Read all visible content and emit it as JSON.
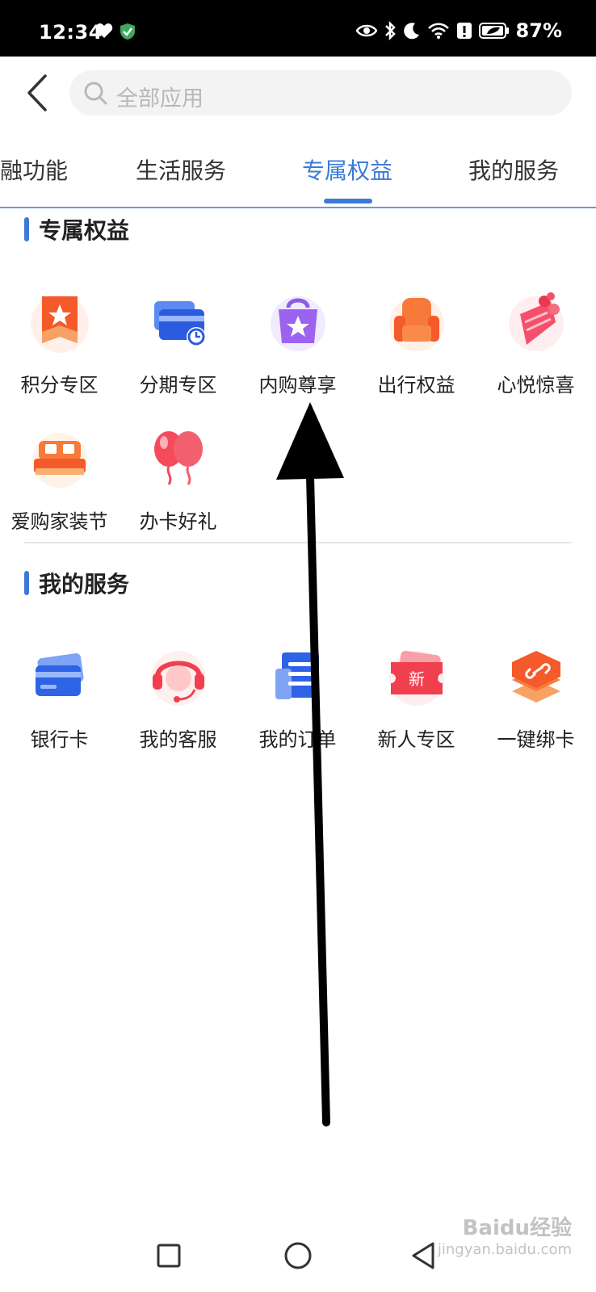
{
  "status_bar": {
    "time": "12:34",
    "battery": "87%"
  },
  "search": {
    "placeholder": "全部应用"
  },
  "tabs": [
    {
      "label": "融功能",
      "active": false
    },
    {
      "label": "生活服务",
      "active": false
    },
    {
      "label": "专属权益",
      "active": true
    },
    {
      "label": "我的服务",
      "active": false
    }
  ],
  "sections": [
    {
      "title": "专属权益",
      "items": [
        {
          "label": "积分专区",
          "icon": "points-icon"
        },
        {
          "label": "分期专区",
          "icon": "installment-icon"
        },
        {
          "label": "内购尊享",
          "icon": "shopping-bag-icon"
        },
        {
          "label": "出行权益",
          "icon": "seat-icon"
        },
        {
          "label": "心悦惊喜",
          "icon": "bouquet-icon"
        },
        {
          "label": "爱购家装节",
          "icon": "sofa-icon"
        },
        {
          "label": "办卡好礼",
          "icon": "balloon-icon"
        }
      ]
    },
    {
      "title": "我的服务",
      "items": [
        {
          "label": "银行卡",
          "icon": "bank-card-icon"
        },
        {
          "label": "我的客服",
          "icon": "customer-service-icon"
        },
        {
          "label": "我的订单",
          "icon": "order-icon"
        },
        {
          "label": "新人专区",
          "icon": "new-ticket-icon",
          "badge": "新"
        },
        {
          "label": "一键绑卡",
          "icon": "link-card-icon"
        }
      ]
    }
  ],
  "watermark": {
    "line1": "Baidu经验",
    "line2": "jingyan.baidu.com"
  },
  "colors": {
    "accent": "#3b7bd6",
    "arrow": "#000000"
  }
}
